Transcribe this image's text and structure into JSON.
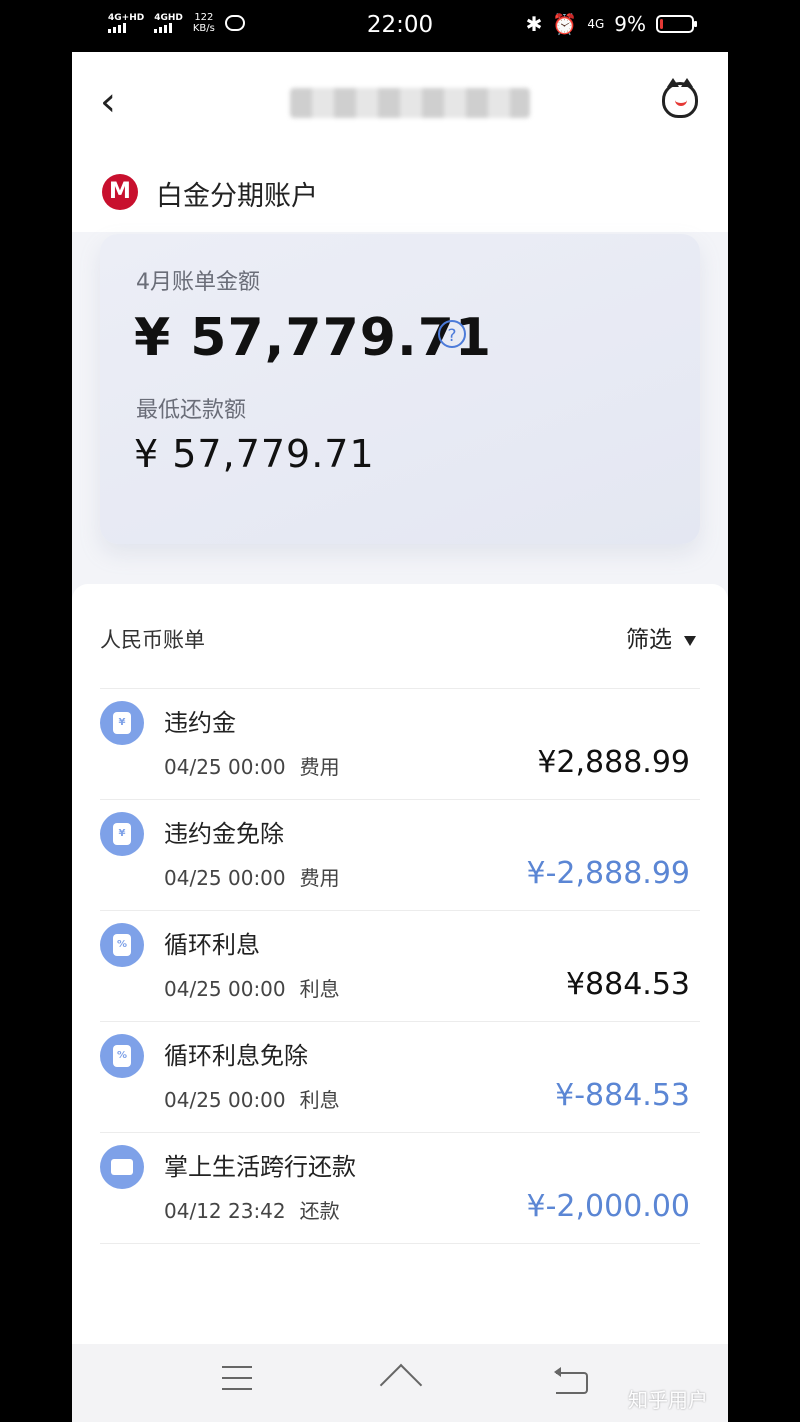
{
  "status_bar": {
    "sim1": "4G+HD",
    "sim2": "4GHD",
    "speed_value": "122",
    "speed_unit": "KB/s",
    "time": "22:00",
    "network": "4G",
    "battery_text": "9%",
    "battery_level": 0.09
  },
  "account": {
    "logo_text": "M",
    "name": "白金分期账户"
  },
  "bill_card": {
    "bill_label": "4月账单金额",
    "bill_amount": "¥ 57,779.71",
    "help_symbol": "?",
    "min_label": "最低还款额",
    "min_amount": "¥ 57,779.71"
  },
  "list": {
    "section_title": "人民币账单",
    "filter_label": "筛选",
    "rows": [
      {
        "title": "违约金",
        "datetime": "04/25 00:00",
        "tag": "费用",
        "amount": "¥2,888.99",
        "icon_text": "¥",
        "icon": "yuan-doc-icon"
      },
      {
        "title": "违约金免除",
        "datetime": "04/25 00:00",
        "tag": "费用",
        "amount": "¥-2,888.99",
        "icon_text": "¥",
        "icon": "yuan-doc-icon"
      },
      {
        "title": "循环利息",
        "datetime": "04/25 00:00",
        "tag": "利息",
        "amount": "¥884.53",
        "icon_text": "%",
        "icon": "percent-doc-icon"
      },
      {
        "title": "循环利息免除",
        "datetime": "04/25 00:00",
        "tag": "利息",
        "amount": "¥-884.53",
        "icon_text": "%",
        "icon": "percent-doc-icon"
      },
      {
        "title": "掌上生活跨行还款",
        "datetime": "04/12 23:42",
        "tag": "还款",
        "amount": "¥-2,000.00",
        "icon_text": "",
        "icon": "card-icon"
      }
    ]
  },
  "watermark": "知乎用户",
  "colors": {
    "negative_amount": "#5b86d4",
    "icon_bg": "#7ea1e8",
    "brand_red": "#c8102e"
  }
}
